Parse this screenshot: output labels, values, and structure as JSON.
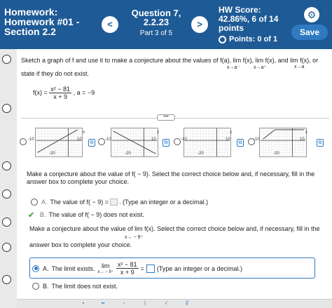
{
  "header": {
    "hw_line1": "Homework:",
    "hw_line2": "Homework #01 -",
    "hw_line3": "Section 2.2",
    "prev": "<",
    "next": ">",
    "question_title": "Question 7,",
    "question_number": "2.2.23",
    "question_part": "Part 3 of 5",
    "score_label": "HW Score:",
    "score_value": "42.86%, 6 of 14",
    "score_unit": "points",
    "points": "Points: 0 of 1",
    "save": "Save",
    "colors": {
      "header_bg": "#1e5a96",
      "save_bg": "#2f7ac0"
    }
  },
  "problem": {
    "prompt": "Sketch a graph of f and use it to make a conjecture about the values of f(a),  lim f(x),  lim f(x), and  lim f(x), or",
    "lim_minus": "x→a⁻",
    "lim_plus": "x→a⁺",
    "lim_a": "x→a",
    "state_line": "state if they do not exist.",
    "func_lhs": "f(x) =",
    "func_num": "x² − 81",
    "func_den": "x + 9",
    "func_a": ", a = −9",
    "dots": "•••"
  },
  "graphs": {
    "tick_x": "x",
    "tick_10": "10",
    "tick_neg10": "-10",
    "tick_neg20": "-20"
  },
  "part1": {
    "prompt": "Make a conjecture about the value of f( − 9). Select the correct choice below and, if necessary, fill in the answer box to complete your choice.",
    "choice_a_letter": "A.",
    "choice_a_text": "The value of f( − 9) =",
    "choice_a_suffix": ". (Type an integer or a decimal.)",
    "choice_b_letter": "B.",
    "choice_b_text": "The value of f( − 9) does not exist."
  },
  "part2": {
    "prompt": "Make a conjecture about the value of   lim   f(x). Select the correct choice below and, if necessary, fill in the",
    "prompt_sub": "x→ − 9⁺",
    "prompt_line2": "answer box to complete your choice.",
    "choice_a_letter": "A.",
    "choice_a_text": "The limit exists.",
    "choice_a_lim": "lim",
    "choice_a_sub": "x→ − 9⁺",
    "choice_a_num": "x² − 81",
    "choice_a_den": "x + 9",
    "choice_a_eq": "=",
    "choice_a_suffix": "(Type an integer or a decimal.)",
    "choice_b_letter": "B.",
    "choice_b_text": "The limit does not exist."
  }
}
